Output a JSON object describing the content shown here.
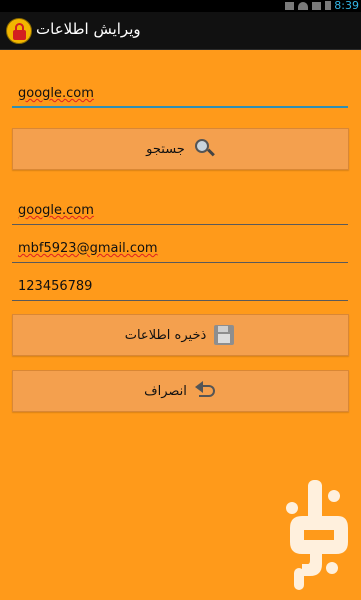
{
  "status_bar": {
    "time": "8:39"
  },
  "action_bar": {
    "title": "ویرایش اطلاعات"
  },
  "search": {
    "value": "google.com"
  },
  "search_button": {
    "label": "جستجو",
    "icon": "search-icon"
  },
  "fields": {
    "site": "google.com",
    "username": "mbf5923@gmail.com",
    "password": "123456789"
  },
  "save_button": {
    "label": "ذخیره اطلاعات",
    "icon": "save-icon"
  },
  "cancel_button": {
    "label": "انصراف",
    "icon": "undo-icon"
  },
  "colors": {
    "background": "#ff9a1a",
    "button": "#f4a04e",
    "accent": "#2f8fb5",
    "status_time": "#33b5e5"
  }
}
